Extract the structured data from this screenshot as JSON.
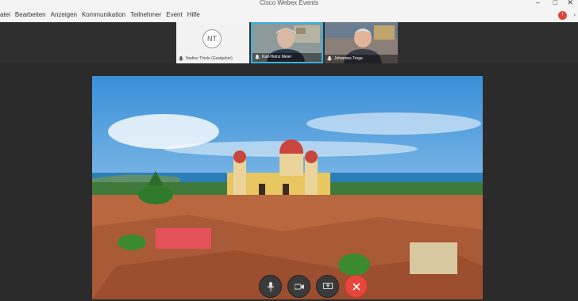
{
  "window": {
    "title": "Cisco Webex Events",
    "minimize": "–",
    "maximize": "□",
    "close": "✕"
  },
  "menu": [
    "atei",
    "Bearbeiten",
    "Anzeigen",
    "Kommunikation",
    "Teilnehmer",
    "Event",
    "Hilfe"
  ],
  "recording_badge": "!",
  "overflow_icon": "›",
  "participants": [
    {
      "initials": "NT",
      "name": "Nadine Thiele (Gastgeber)"
    },
    {
      "name": "Karl-Heinz Meier"
    },
    {
      "name": "Johannes Troge"
    }
  ],
  "colors": {
    "accent": "#3ab0e0",
    "end_call": "#e8453c"
  },
  "controls": [
    "mute-icon",
    "video-icon",
    "share-icon",
    "end-call-icon"
  ]
}
